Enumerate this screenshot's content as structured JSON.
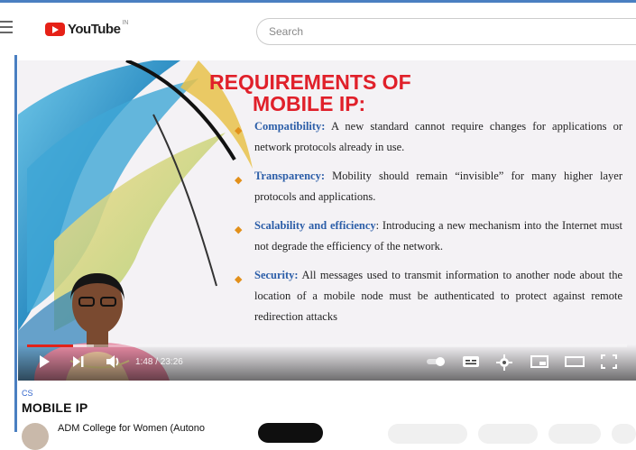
{
  "header": {
    "logo_text": "YouTube",
    "logo_superscript": "IN",
    "search_placeholder": "Search"
  },
  "slide": {
    "title_line1": "REQUIREMENTS OF",
    "title_line2": "MOBILE IP:",
    "bullets": [
      {
        "term": "Compatibility:",
        "text": " A new standard cannot require changes for applications or network protocols already in use."
      },
      {
        "term": "Transparency:",
        "text": " Mobility should remain “invisible” for many higher layer protocols and applications."
      },
      {
        "term": "Scalability and efficiency",
        "text": ": Introducing a new mechanism into the Internet must not degrade the efficiency of the network."
      },
      {
        "term": "Security:",
        "text": " All messages used to transmit information to another node about the location of a mobile node must be authenticated to protect against remote redirection attacks"
      }
    ]
  },
  "player": {
    "time_text": "1:48 / 23:26",
    "progress_fraction": 0.077,
    "buffer_fraction": 0.035
  },
  "video_info": {
    "tag": "CS",
    "title": "MOBILE IP",
    "channel_name": "ADM College for Women (Autono"
  },
  "colors": {
    "youtube_red": "#e62117",
    "slide_title": "#e0202a",
    "bullet_term": "#2c5ea8",
    "progress": "#e2231a"
  }
}
